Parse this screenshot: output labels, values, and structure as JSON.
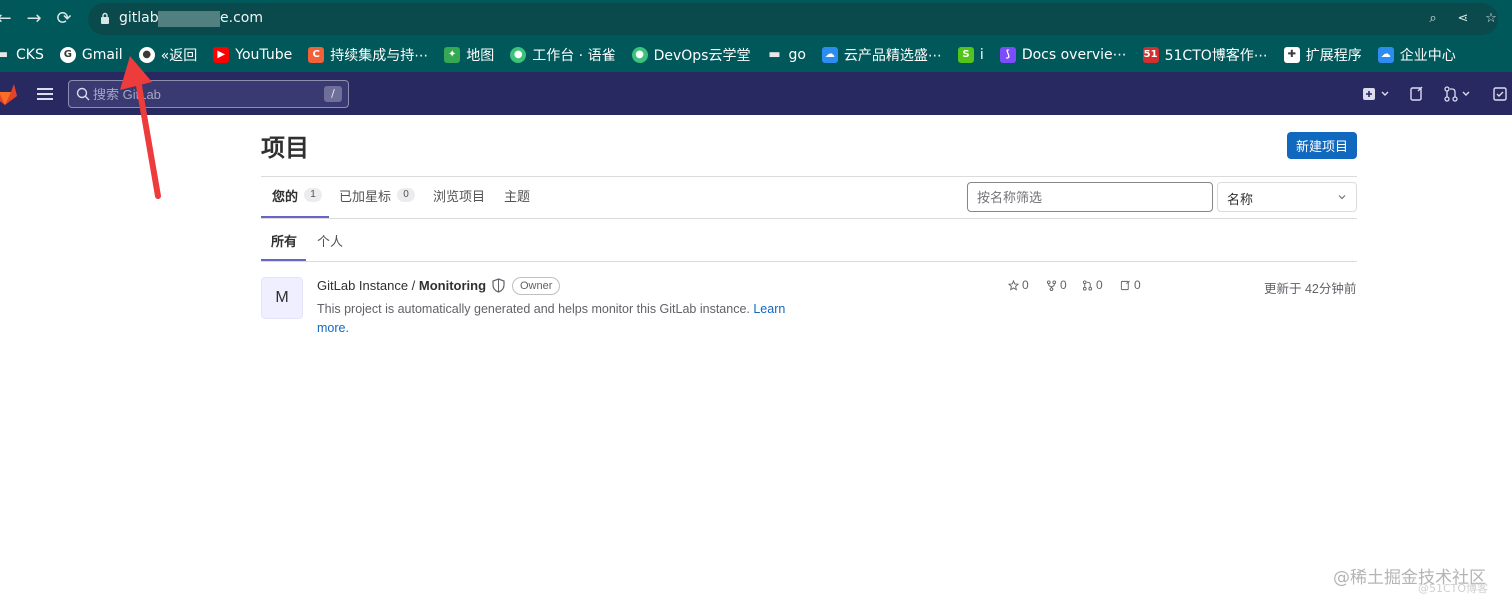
{
  "browser": {
    "url_prefix": "gitlab",
    "url_suffix": "e.com",
    "url_icons": [
      "zoom-icon",
      "share-icon",
      "star-icon"
    ]
  },
  "bookmarks": [
    {
      "label": "CKS",
      "icon": "folder-icon",
      "color": "#e8e8e8"
    },
    {
      "label": "Gmail",
      "icon": "google-icon",
      "color": "#ffffff"
    },
    {
      "label": "«返回",
      "icon": "globe-icon",
      "color": "#ffffff"
    },
    {
      "label": "YouTube",
      "icon": "youtube-icon",
      "color": "#ff0000"
    },
    {
      "label": "持续集成与持⋯",
      "icon": "csdn-icon",
      "color": "#f1623b"
    },
    {
      "label": "地图",
      "icon": "maps-icon",
      "color": "#34a853"
    },
    {
      "label": "工作台 · 语雀",
      "icon": "yuque-icon",
      "color": "#3cc27a"
    },
    {
      "label": "DevOps云学堂",
      "icon": "yuque-icon",
      "color": "#3cc27a"
    },
    {
      "label": "go",
      "icon": "folder-icon",
      "color": "#e8e8e8"
    },
    {
      "label": "云产品精选盛⋯",
      "icon": "cloud-icon",
      "color": "#2d8cf0"
    },
    {
      "label": "i",
      "icon": "green-s-icon",
      "color": "#52c41a"
    },
    {
      "label": "Docs overvie⋯",
      "icon": "docs-icon",
      "color": "#7c4dff"
    },
    {
      "label": "51CTO博客作⋯",
      "icon": "51cto-icon",
      "color": "#d32f2f"
    },
    {
      "label": "扩展程序",
      "icon": "puzzle-icon",
      "color": "#ffffff"
    },
    {
      "label": "企业中心",
      "icon": "cloud-icon",
      "color": "#2d8cf0"
    }
  ],
  "header": {
    "search_placeholder": "搜索 GitLab",
    "search_shortcut": "/"
  },
  "page": {
    "title": "项目",
    "new_project_label": "新建项目",
    "tabs": [
      {
        "label": "您的",
        "count": "1"
      },
      {
        "label": "已加星标",
        "count": "0"
      },
      {
        "label": "浏览项目"
      },
      {
        "label": "主题"
      }
    ],
    "filter_placeholder": "按名称筛选",
    "sort_value": "名称",
    "subtabs": [
      {
        "label": "所有"
      },
      {
        "label": "个人"
      }
    ]
  },
  "project": {
    "avatar_letter": "M",
    "namespace": "GitLab Instance / ",
    "name": "Monitoring",
    "role": "Owner",
    "description": "This project is automatically generated and helps monitor this GitLab instance. ",
    "learn_more": "Learn more.",
    "stars": "0",
    "forks": "0",
    "merge_requests": "0",
    "issues": "0",
    "updated": "更新于 42分钟前"
  },
  "watermark": {
    "main": "@稀土掘金技术社区",
    "sub": "@51CTO博客"
  }
}
